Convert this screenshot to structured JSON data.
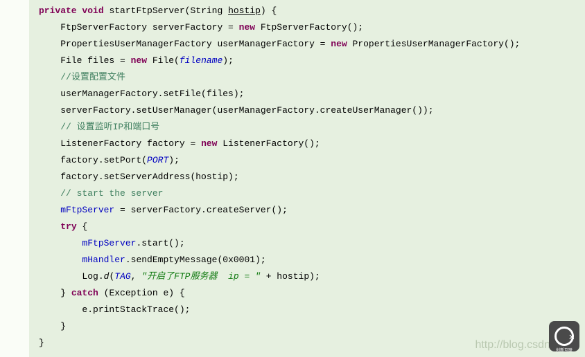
{
  "code": {
    "l1_kw1": "private",
    "l1_kw2": "void",
    "l1_name": " startFtpServer(String ",
    "l1_param": "hostip",
    "l1_end": ") {",
    "l2_a": "FtpServerFactory serverFactory = ",
    "l2_kw": "new",
    "l2_b": " FtpServerFactory();",
    "l3_a": "PropertiesUserManagerFactory userManagerFactory = ",
    "l3_kw": "new",
    "l3_b": " PropertiesUserManagerFactory();",
    "l4_a": "File files = ",
    "l4_kw": "new",
    "l4_b": " File(",
    "l4_fld": "filename",
    "l4_c": ");",
    "l5_com": "//设置配置文件",
    "l6": "userManagerFactory.setFile(files);",
    "l7": "serverFactory.setUserManager(userManagerFactory.createUserManager());",
    "l8_com": "// 设置监听IP和端口号",
    "l9_a": "ListenerFactory factory = ",
    "l9_kw": "new",
    "l9_b": " ListenerFactory();",
    "l10_a": "factory.setPort(",
    "l10_fld": "PORT",
    "l10_b": ");",
    "l11": "factory.setServerAddress(hostip);",
    "l12_com": "// start the server",
    "l13_a": "mFtpServer",
    "l13_b": " = serverFactory.createServer();",
    "l14_kw": "try",
    "l14_b": " {",
    "l15_a": "mFtpServer",
    "l15_b": ".start();",
    "l16_a": "mHandler",
    "l16_b": ".sendEmptyMessage(0x0001);",
    "l17_a": "Log.",
    "l17_m": "d",
    "l17_b": "(",
    "l17_tag": "TAG",
    "l17_c": ", ",
    "l17_s1": "\"开启了FTP服务器  ip = \"",
    "l17_d": " + hostip);",
    "l18_a": "} ",
    "l18_kw": "catch",
    "l18_b": " (Exception e) {",
    "l19": "e.printStackTrace();",
    "l20": "}",
    "l21": "}"
  },
  "watermark": "http://blog.csdn.net/a",
  "logo_text": "创新互联"
}
